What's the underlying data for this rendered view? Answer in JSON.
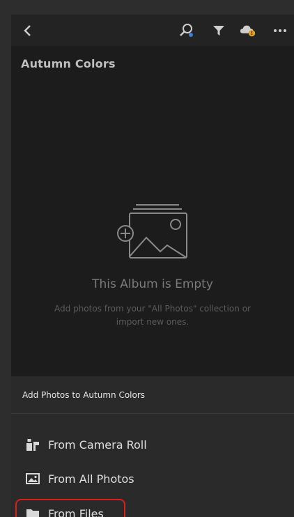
{
  "album": {
    "title": "Autumn Colors"
  },
  "empty_state": {
    "title": "This Album is Empty",
    "description": "Add photos from your \"All Photos\" collection or import new ones."
  },
  "toolbar": {
    "icons": [
      "back-icon",
      "search-icon",
      "filter-icon",
      "cloud-icon",
      "more-icon"
    ],
    "more_label": "•••"
  },
  "sheet": {
    "header": "Add Photos to Autumn Colors",
    "items": [
      {
        "label": "From Camera Roll",
        "icon": "camera-roll-icon"
      },
      {
        "label": "From All Photos",
        "icon": "photos-icon"
      },
      {
        "label": "From Files",
        "icon": "folder-icon"
      }
    ]
  },
  "colors": {
    "highlight": "#d81e1e",
    "badge": "#e3a21a"
  }
}
